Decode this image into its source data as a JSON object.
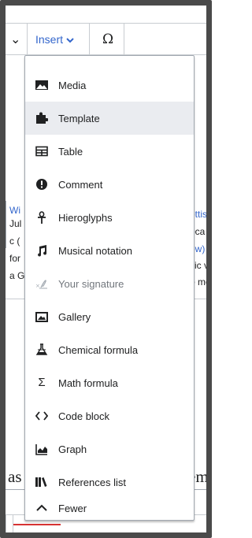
{
  "toolbar": {
    "insert_label": "Insert",
    "special_char": "Ω"
  },
  "background": {
    "frag1": "Wi",
    "frag2": "Jul",
    "frag3": "c (",
    "frag4": "for",
    "frag5": "a G",
    "frag6": "ottis",
    "frag7": "oca",
    "frag8": "ow)",
    "frag9": "sic v",
    "frag10": "o me",
    "heading_left": "as",
    "heading_right": "em"
  },
  "menu": {
    "items": [
      {
        "label": "Media",
        "icon": "image-icon"
      },
      {
        "label": "Template",
        "icon": "puzzle-icon"
      },
      {
        "label": "Table",
        "icon": "table-icon"
      },
      {
        "label": "Comment",
        "icon": "speech-bubble-icon"
      },
      {
        "label": "Hieroglyphs",
        "icon": "ankh-icon"
      },
      {
        "label": "Musical notation",
        "icon": "music-note-icon"
      },
      {
        "label": "Your signature",
        "icon": "signature-icon"
      },
      {
        "label": "Gallery",
        "icon": "gallery-icon"
      },
      {
        "label": "Chemical formula",
        "icon": "flask-icon"
      },
      {
        "label": "Math formula",
        "icon": "sigma-icon"
      },
      {
        "label": "Code block",
        "icon": "code-icon"
      },
      {
        "label": "Graph",
        "icon": "graph-icon"
      },
      {
        "label": "References list",
        "icon": "references-icon"
      },
      {
        "label": "Fewer",
        "icon": "collapse-icon"
      }
    ]
  },
  "colors": {
    "link": "#3366cc",
    "text": "#202122",
    "hover": "#eaecf0",
    "disabled": "#72777d"
  }
}
